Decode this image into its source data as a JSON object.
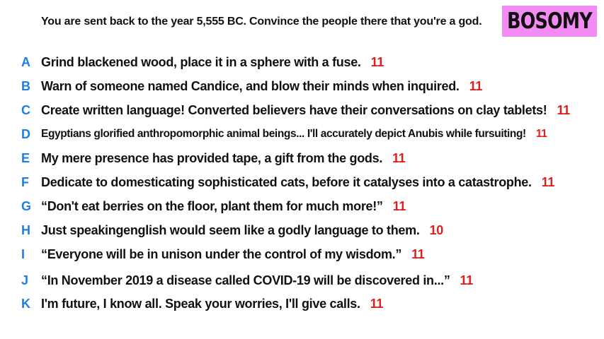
{
  "prompt": "You are sent back to the year 5,555 BC. Convince the people there that you're a god.",
  "brand": "BOSOMY",
  "colors": {
    "letter": "#1f7de8",
    "score": "#e01e1e",
    "brand_bg": "#f28cf2"
  },
  "answers": [
    {
      "letter": "A",
      "text": "Grind blackened wood, place it in a sphere with a fuse.",
      "score": "11"
    },
    {
      "letter": "B",
      "text": "Warn of someone named Candice, and blow their minds when inquired.",
      "score": "11"
    },
    {
      "letter": "C",
      "text": "Create written language! Converted believers have their conversations on clay tablets!",
      "score": "11"
    },
    {
      "letter": "D",
      "text": "Egyptians glorified anthropomorphic animal beings... I'll accurately depict Anubis while fursuiting!",
      "score": "11"
    },
    {
      "letter": "E",
      "text": "My mere presence has provided tape, a gift from the gods.",
      "score": "11"
    },
    {
      "letter": "F",
      "text": "Dedicate to domesticating sophisticated cats, before it catalyses into a catastrophe.",
      "score": "11"
    },
    {
      "letter": "G",
      "text": "“Don't eat berries on the floor, plant them for much more!”",
      "score": "11"
    },
    {
      "letter": "H",
      "text": "Just speakingenglish would seem like a godly language to them.",
      "score": "10"
    },
    {
      "letter": "I",
      "text": "“Everyone will be in unison under the control of my wisdom.”",
      "score": "11"
    },
    {
      "letter": "J",
      "text": "“In November 2019 a disease called COVID-19 will be discovered in...”",
      "score": "11"
    },
    {
      "letter": "K",
      "text": "I'm future, I know all. Speak your worries, I'll give calls.",
      "score": "11"
    }
  ]
}
